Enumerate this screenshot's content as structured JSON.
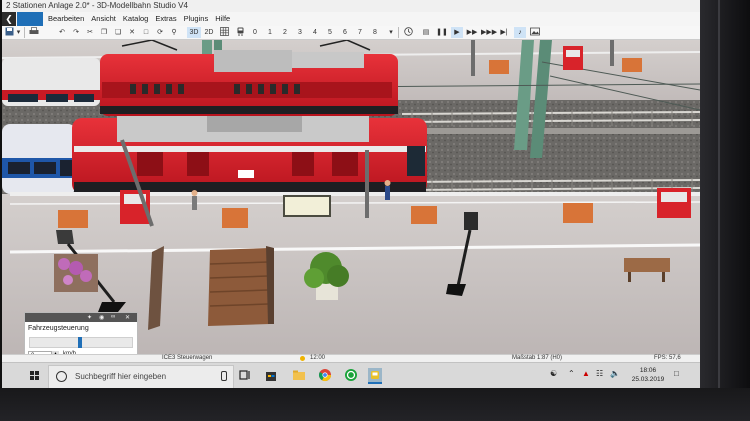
{
  "window": {
    "title": "2 Stationen Anlage 2.0* - 3D-Modellbahn Studio V4"
  },
  "menubar": {
    "file_tab": "",
    "items": [
      "Bearbeiten",
      "Ansicht",
      "Katalog",
      "Extras",
      "Plugins",
      "Hilfe"
    ]
  },
  "toolbar": {
    "view_3d": "3D",
    "view_2d": "2D",
    "numbers": [
      "0",
      "1",
      "2",
      "3",
      "4",
      "5",
      "6",
      "7",
      "8"
    ],
    "icons": [
      "back-icon",
      "save-icon",
      "print-icon",
      "grid-icon",
      "train-icon",
      "clock-icon",
      "pause-icon",
      "play-icon",
      "fast-forward-icon",
      "skip-icon",
      "sound-icon",
      "screenshot-icon"
    ]
  },
  "vehicle_panel": {
    "title": "Fahrzeugsteuerung",
    "speed_value": "0",
    "speed_unit": "km/h",
    "speed_level": 0.5
  },
  "statusbar": {
    "vehicle_name": "ICE3 Steuerwagen",
    "time": "12:00",
    "scale": "Maßstab 1:87 (H0)",
    "fps": "FPS: 57,6"
  },
  "taskbar": {
    "search_placeholder": "Suchbegriff hier eingeben",
    "clock_time": "18:06",
    "clock_date": "25.03.2019"
  },
  "colors": {
    "loco_red": "#d8202a",
    "platform": "#c5bfbe",
    "ballast": "#6b6966",
    "accent_blue": "#1f6fb7"
  }
}
